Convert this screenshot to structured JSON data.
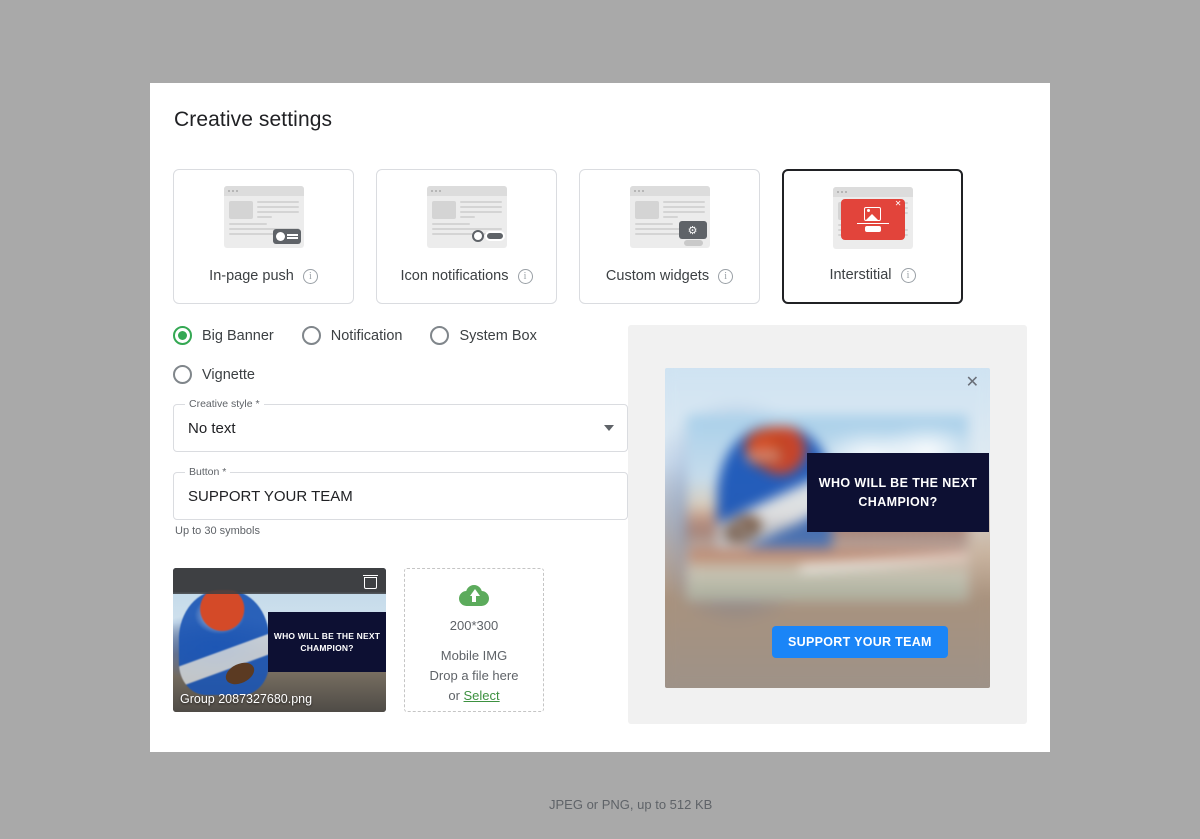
{
  "page": {
    "title": "Creative settings"
  },
  "format_cards": [
    {
      "label": "In-page push",
      "icon": "in-page-push-icon",
      "info_icon": "info-icon",
      "selected": false
    },
    {
      "label": "Icon notifications",
      "icon": "icon-notifications-icon",
      "info_icon": "info-icon",
      "selected": false
    },
    {
      "label": "Custom widgets",
      "icon": "custom-widgets-icon",
      "info_icon": "info-icon",
      "selected": false
    },
    {
      "label": "Interstitial",
      "icon": "interstitial-icon",
      "info_icon": "info-icon",
      "selected": true
    }
  ],
  "radios": [
    {
      "label": "Big Banner",
      "selected": true
    },
    {
      "label": "Notification",
      "selected": false
    },
    {
      "label": "System Box",
      "selected": false
    },
    {
      "label": "Vignette",
      "selected": false
    }
  ],
  "fields": {
    "creative_style": {
      "legend": "Creative style *",
      "value": "No text",
      "caret_icon": "chevron-down-icon"
    },
    "button": {
      "legend": "Button *",
      "value": "SUPPORT YOUR TEAM",
      "helper": "Up to 30 symbols"
    }
  },
  "uploads": {
    "thumbnail": {
      "filename": "Group 2087327680.png",
      "overlay_text": "WHO WILL BE THE NEXT CHAMPION?",
      "delete_icon": "trash-icon"
    },
    "dropzone": {
      "upload_icon": "cloud-upload-icon",
      "dimensions": "200*300",
      "title": "Mobile IMG",
      "drop_text": "Drop a file here",
      "or_text": "or ",
      "select_link": "Select"
    },
    "format_note": "JPEG or PNG, up to 512 KB"
  },
  "preview": {
    "close_icon": "close-icon",
    "headline": "WHO WILL BE THE NEXT CHAMPION?",
    "cta_label": "SUPPORT YOUR TEAM"
  },
  "colors": {
    "accent_green": "#34a853",
    "cta_blue": "#1a85f7",
    "navy": "#0d1033",
    "interstitial_red": "#e2443b",
    "page_background": "#a9a9a9",
    "panel_background": "#ffffff",
    "preview_background": "#f1f1f1"
  }
}
